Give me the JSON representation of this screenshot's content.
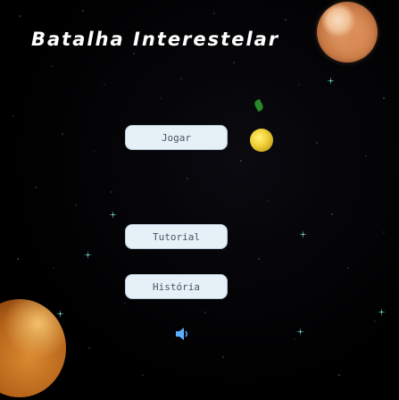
{
  "game": {
    "title": "Batalha Interestelar"
  },
  "menu": {
    "play_label": "Jogar",
    "tutorial_label": "Tutorial",
    "story_label": "História"
  },
  "colors": {
    "background": "#000000",
    "title": "#ffffff",
    "button_fill": "#e6f0f7",
    "button_text": "#4a5560",
    "sound_icon": "#5ab0ff"
  },
  "icons": {
    "sound": "speaker-icon"
  }
}
